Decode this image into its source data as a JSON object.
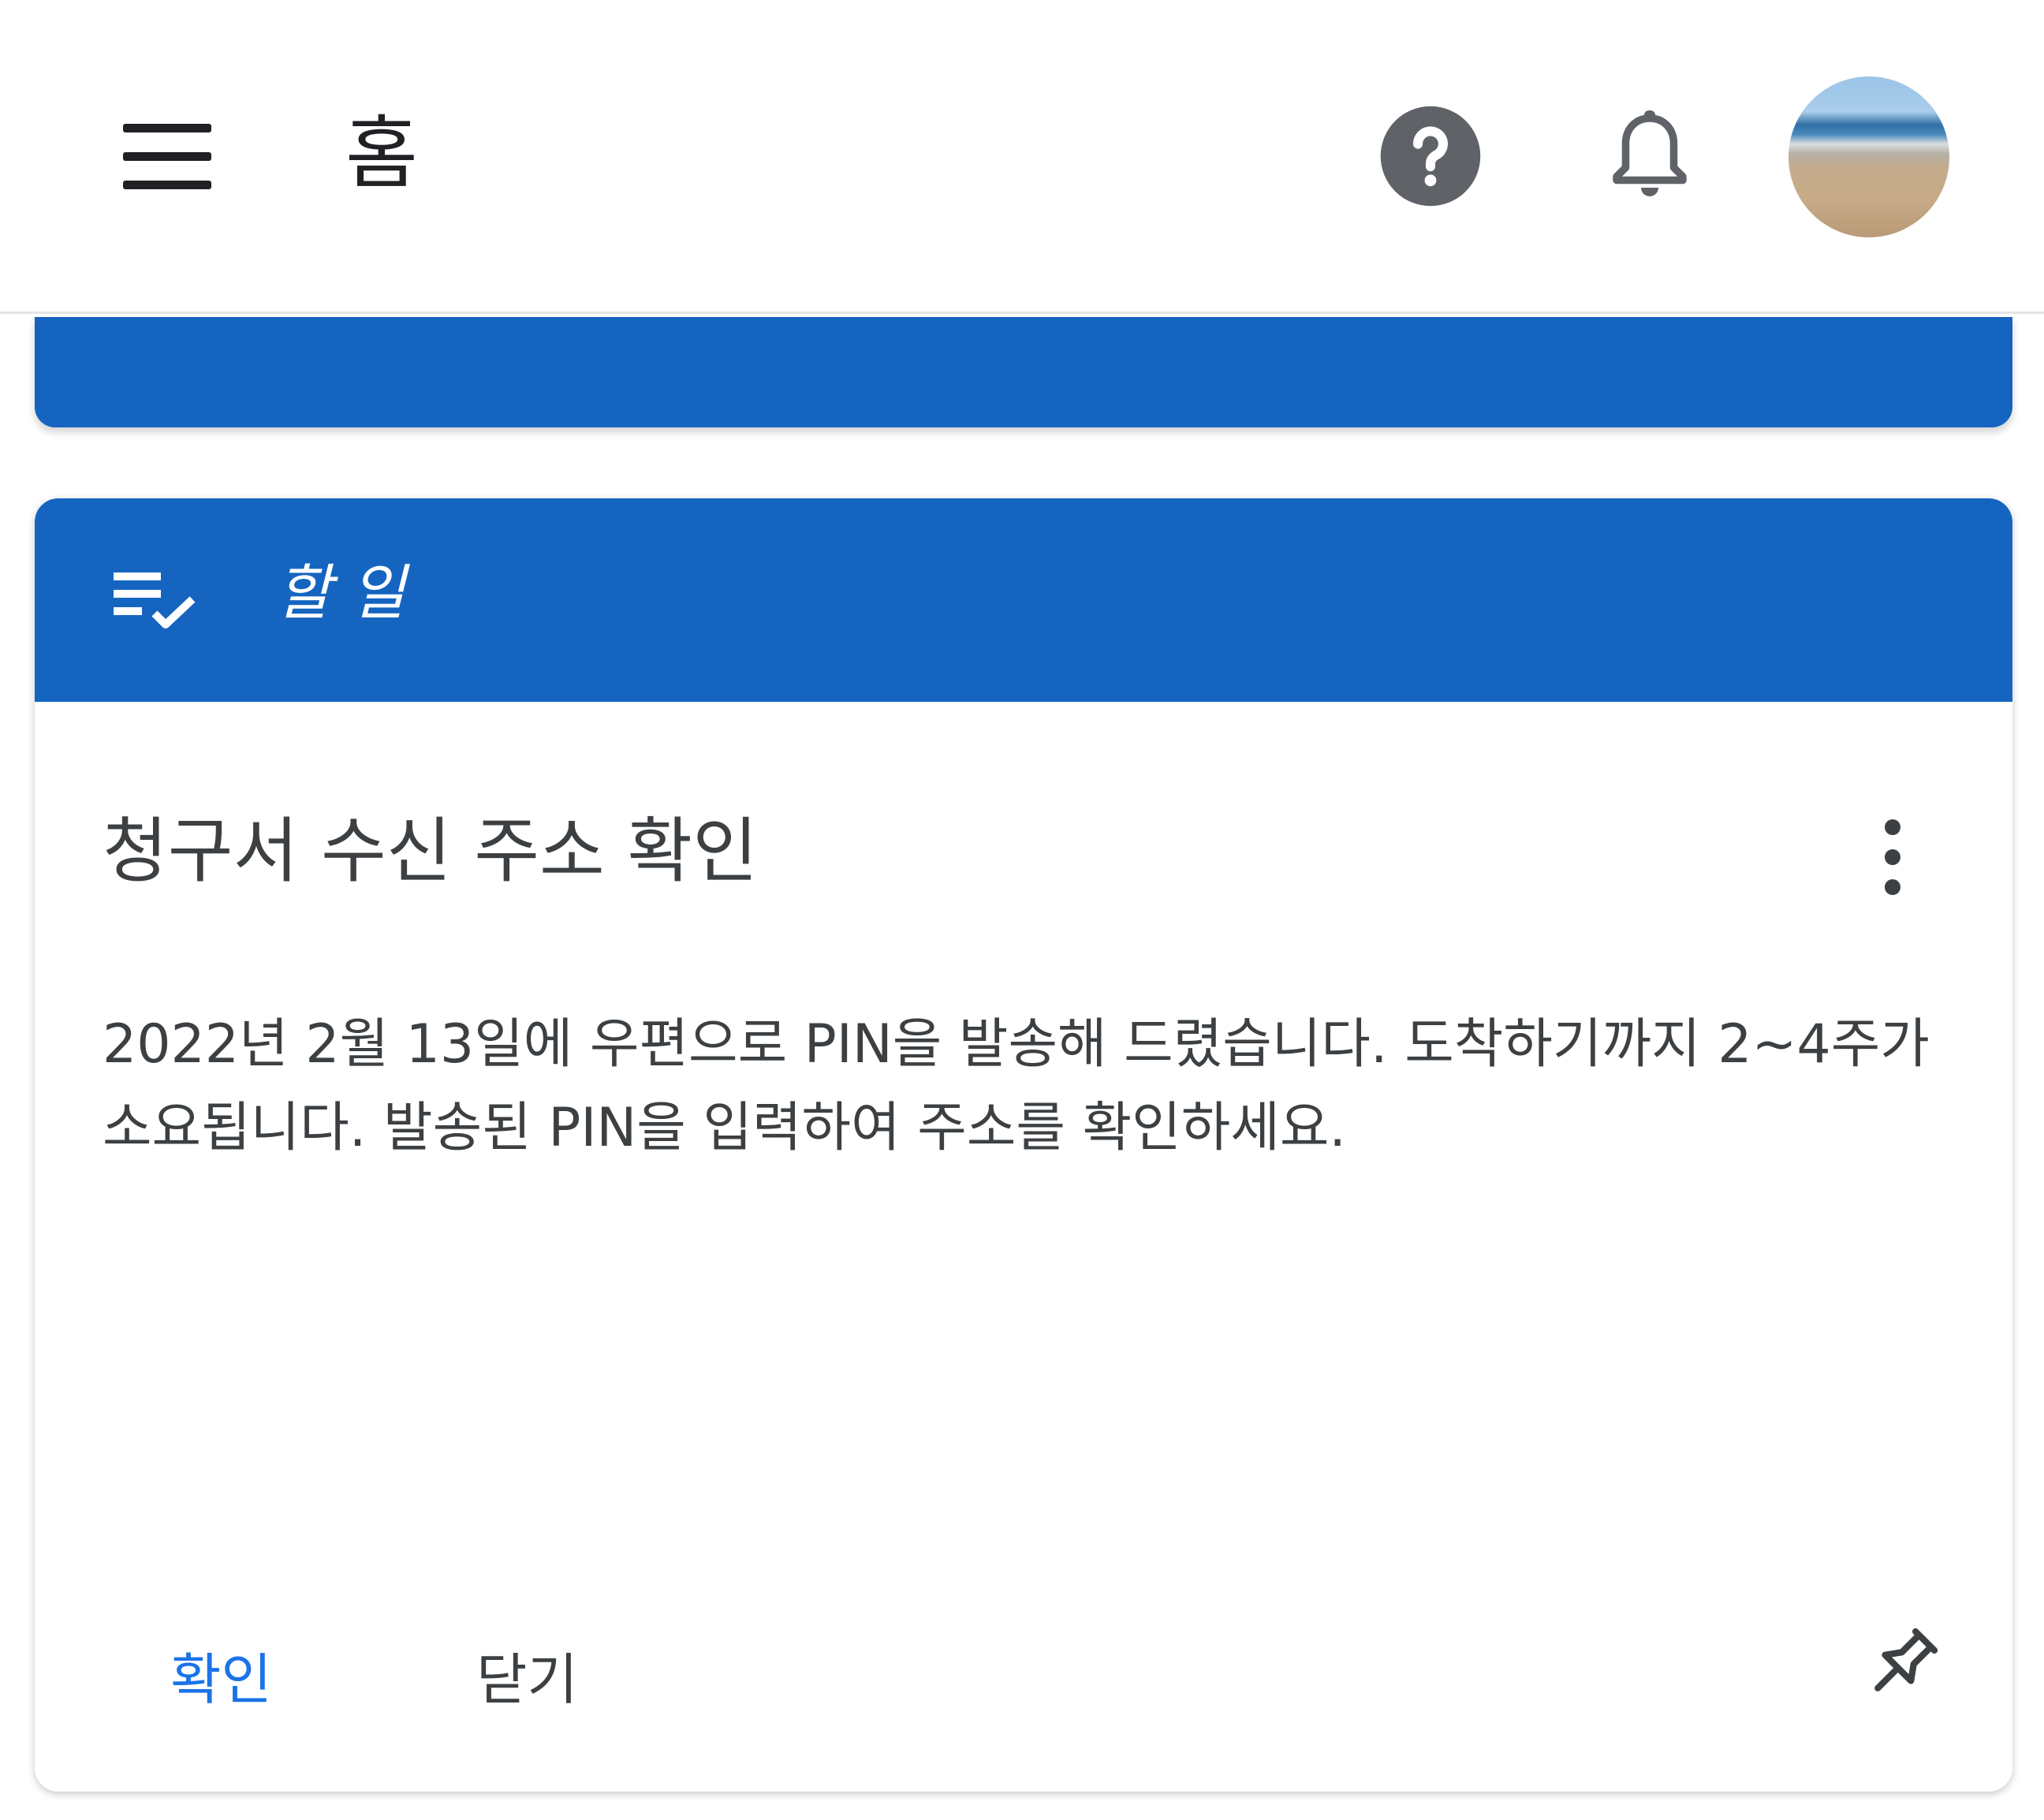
{
  "app_bar": {
    "title": "홈",
    "icons": {
      "menu": "menu-icon",
      "help": "help-icon",
      "notifications": "bell-icon",
      "account": "avatar"
    }
  },
  "todo_card": {
    "header_icon": "checklist-icon",
    "header_title": "할 일",
    "item": {
      "title": "청구서 수신 주소 확인",
      "body": "2022년 2월 13일에 우편으로 PIN을 발송해 드렸습니다. 도착하기까지 2~4주가 소요됩니다. 발송된 PIN을 입력하여 주소를 확인하세요.",
      "actions": {
        "confirm_label": "확인",
        "close_label": "닫기"
      }
    }
  },
  "colors": {
    "primary": "#1565c0",
    "accent_text": "#1a73e8",
    "text": "#3c4043"
  }
}
